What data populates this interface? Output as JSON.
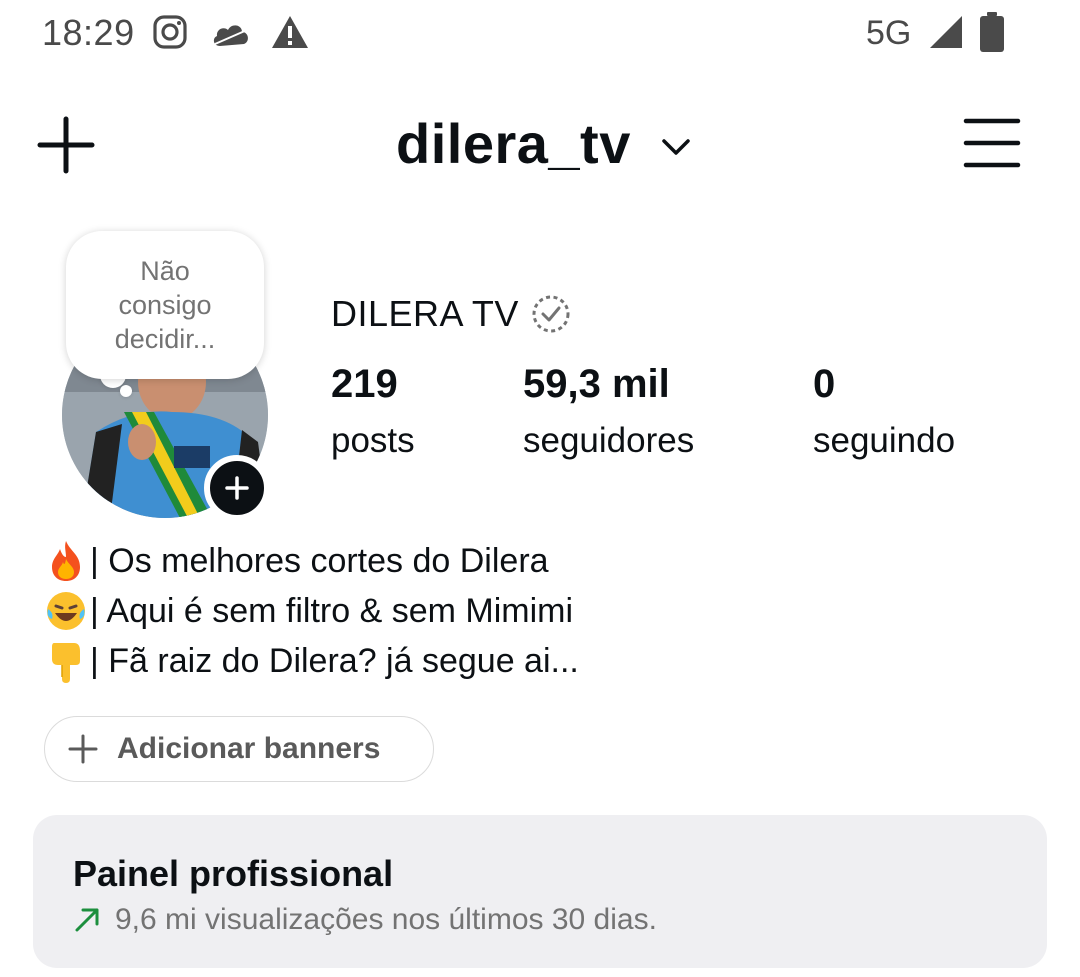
{
  "status_bar": {
    "time": "18:29",
    "network": "5G",
    "icons": [
      "instagram-icon",
      "cloud-icon",
      "warning-icon",
      "signal-icon",
      "battery-icon"
    ]
  },
  "header": {
    "username": "dilera_tv",
    "icons": [
      "plus-icon",
      "chevron-down-icon",
      "menu-icon"
    ]
  },
  "profile": {
    "note": "Não consigo decidir...",
    "display_name": "DILERA TV",
    "stats": [
      {
        "value": "219",
        "label": "posts"
      },
      {
        "value": "59,3 mil",
        "label": "seguidores"
      },
      {
        "value": "0",
        "label": "seguindo"
      }
    ],
    "bio": [
      {
        "emoji": "fire-emoji",
        "text": "| Os melhores cortes do Dilera"
      },
      {
        "emoji": "laughing-emoji",
        "text": "| Aqui é sem filtro & sem Mimimi"
      },
      {
        "emoji": "pointing-down-emoji",
        "text": "| Fã raiz do Dilera? já segue ai..."
      }
    ]
  },
  "banner_button": {
    "label": "Adicionar banners"
  },
  "professional_panel": {
    "title": "Painel profissional",
    "subtitle": "9,6 mi visualizações nos últimos 30 dias."
  },
  "colors": {
    "text": "#0c1014",
    "secondary_text": "#737373",
    "panel_bg": "#efeff2",
    "trend_green": "#1c8f3e"
  }
}
